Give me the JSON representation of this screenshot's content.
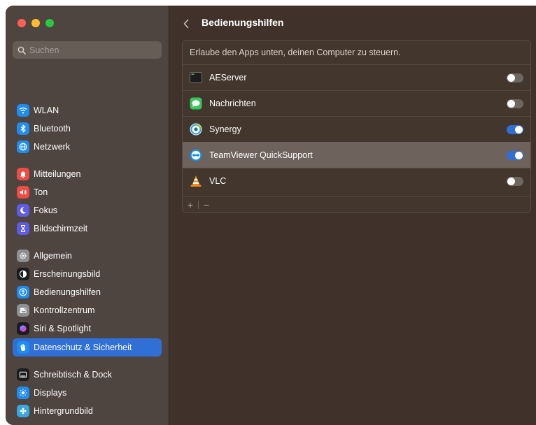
{
  "search": {
    "placeholder": "Suchen"
  },
  "sidebar": {
    "items": [
      {
        "label": "WLAN",
        "icon": "wifi-icon",
        "color": "#1e8cf0"
      },
      {
        "label": "Bluetooth",
        "icon": "bluetooth-icon",
        "color": "#1e8cf0"
      },
      {
        "label": "Netzwerk",
        "icon": "globe-icon",
        "color": "#1e8cf0"
      },
      {
        "label": "Mitteilungen",
        "icon": "bell-icon",
        "color": "#ee4c45"
      },
      {
        "label": "Ton",
        "icon": "speaker-icon",
        "color": "#ee4c45"
      },
      {
        "label": "Fokus",
        "icon": "moon-icon",
        "color": "#5e5ce6"
      },
      {
        "label": "Bildschirmzeit",
        "icon": "hourglass-icon",
        "color": "#5e5ce6"
      },
      {
        "label": "Allgemein",
        "icon": "gear-icon",
        "color": "#8e8e93"
      },
      {
        "label": "Erscheinungsbild",
        "icon": "appearance-icon",
        "color": "#1c1c1e"
      },
      {
        "label": "Bedienungshilfen",
        "icon": "accessibility-icon",
        "color": "#1e8cf0"
      },
      {
        "label": "Kontrollzentrum",
        "icon": "toggles-icon",
        "color": "#8e8e93"
      },
      {
        "label": "Siri & Spotlight",
        "icon": "siri-icon",
        "color": "#6b3fb8"
      },
      {
        "label": "Datenschutz & Sicherheit",
        "icon": "hand-icon",
        "color": "#1e8cf0",
        "selected": true
      },
      {
        "label": "Schreibtisch & Dock",
        "icon": "dock-icon",
        "color": "#1c1c1e"
      },
      {
        "label": "Displays",
        "icon": "sun-icon",
        "color": "#1e8cf0"
      },
      {
        "label": "Hintergrundbild",
        "icon": "wallpaper-icon",
        "color": "#3aa7e0"
      }
    ]
  },
  "header": {
    "title": "Bedienungshilfen"
  },
  "panel": {
    "description": "Erlaube den Apps unten, deinen Computer zu steuern.",
    "apps": [
      {
        "name": "AEServer",
        "icon": "terminal-icon",
        "enabled": false
      },
      {
        "name": "Nachrichten",
        "icon": "messages-icon",
        "enabled": false
      },
      {
        "name": "Synergy",
        "icon": "synergy-icon",
        "enabled": true
      },
      {
        "name": "TeamViewer QuickSupport",
        "icon": "teamviewer-icon",
        "enabled": true,
        "highlighted": true
      },
      {
        "name": "VLC",
        "icon": "vlc-cone-icon",
        "enabled": false
      }
    ],
    "footer": {
      "add": "+",
      "remove": "−"
    }
  },
  "colors": {
    "accent": "#2f6fd6",
    "sidebar_bg": "#4e4540",
    "content_bg": "#40322a"
  }
}
